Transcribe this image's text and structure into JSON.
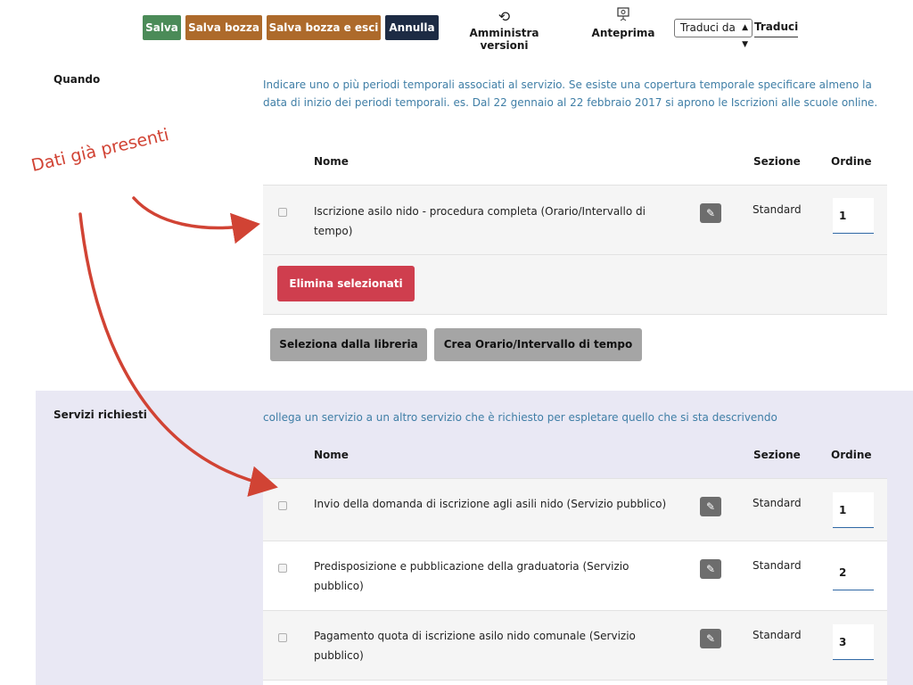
{
  "toolbar": {
    "save_label": "Salva",
    "save_draft_label": "Salva bozza",
    "save_draft_exit_label": "Salva bozza e esci",
    "cancel_label": "Annulla",
    "versions_label": "Amministra versioni",
    "preview_label": "Anteprima",
    "translate_from_value": "Traduci da",
    "translate_label": "Traduci"
  },
  "annotation": {
    "text": "Dati già presenti",
    "color": "#d14334"
  },
  "sections": {
    "quando": {
      "title": "Quando",
      "description": "Indicare uno o più periodi temporali associati al servizio. Se esiste una copertura temporale specificare almeno la data di inizio dei periodi temporali. es. Dal 22 gennaio al 22 febbraio 2017 si aprono le Iscrizioni alle scuole online.",
      "columns": {
        "name": "Nome",
        "section": "Sezione",
        "order": "Ordine"
      },
      "rows": [
        {
          "name": "Iscrizione asilo nido - procedura completa (Orario/Intervallo di tempo)",
          "section": "Standard",
          "order": "1"
        }
      ],
      "delete_selected_label": "Elimina selezionati",
      "select_from_library_label": "Seleziona dalla libreria",
      "create_time_label": "Crea Orario/Intervallo di tempo"
    },
    "servizi": {
      "title": "Servizi richiesti",
      "description": "collega un servizio a un altro servizio che è richiesto per espletare quello che si sta descrivendo",
      "columns": {
        "name": "Nome",
        "section": "Sezione",
        "order": "Ordine"
      },
      "rows": [
        {
          "name": "Invio della domanda di iscrizione agli asili nido (Servizio pubblico)",
          "section": "Standard",
          "order": "1"
        },
        {
          "name": "Predisposizione e pubblicazione della graduatoria (Servizio pubblico)",
          "section": "Standard",
          "order": "2"
        },
        {
          "name": "Pagamento quota di iscrizione asilo nido comunale (Servizio pubblico)",
          "section": "Standard",
          "order": "3"
        }
      ]
    }
  },
  "colors": {
    "green": "#4b8b58",
    "brown": "#ad6a2b",
    "navy": "#1d2b44",
    "red": "#cf3e4e",
    "link_blue": "#3f7ea6",
    "lavender": "#e9e8f4"
  }
}
